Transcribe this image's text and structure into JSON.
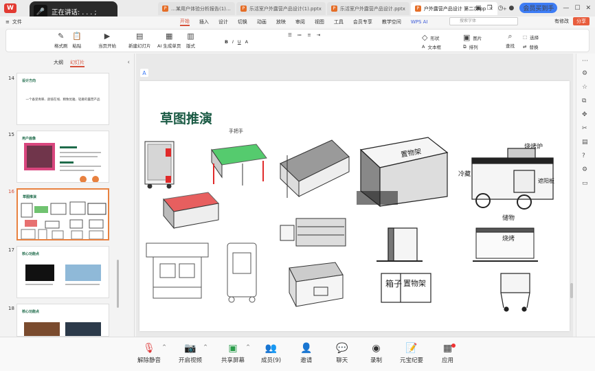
{
  "titlebar": {
    "logo": "W",
    "tabs": [
      {
        "label": "…某用户体验分析报告(1)…",
        "active": false
      },
      {
        "label": "乐活室户外露营产品设计(1).pptx",
        "active": false
      },
      {
        "label": "乐活室户外露营产品设计.pptx",
        "active": false
      },
      {
        "label": "户外露营产品设计 第二次.pp",
        "active": true
      }
    ],
    "new_tab": "+",
    "vip_label": "会员买到手"
  },
  "speaking": {
    "label": "正在讲话:  . . . ;"
  },
  "menubar": {
    "file": "文件",
    "items": [
      "开始",
      "插入",
      "设计",
      "切换",
      "动画",
      "放映",
      "审阅",
      "视图",
      "工具",
      "会员专享",
      "教学空间",
      "WPS AI"
    ],
    "active": "开始",
    "search_placeholder": "搜索字体",
    "right": [
      "有修改",
      "分享"
    ]
  },
  "ribbon": {
    "buttons": [
      "格式刷",
      "粘贴",
      "当页开始",
      "新建幻灯片",
      "AI 生成单页",
      "版式",
      "文本框",
      "排列",
      "查找",
      "形状",
      "图片",
      "选择",
      "替换"
    ]
  },
  "sidebar": {
    "tabs": [
      "大纲",
      "幻灯片"
    ],
    "active_tab": "幻灯片",
    "slides": [
      {
        "num": "14",
        "title": "设计方向",
        "text": "一个备受青睐、颜值在线、精致优雅、轻奢的露营产品"
      },
      {
        "num": "15",
        "title": "用户画像",
        "text": ""
      },
      {
        "num": "16",
        "title": "草图推演",
        "text": ""
      },
      {
        "num": "17",
        "title": "核心功能点",
        "text": ""
      },
      {
        "num": "18",
        "title": "核心功能点",
        "text": ""
      }
    ],
    "selected": "16"
  },
  "slide": {
    "title": "草图推演",
    "annotations": [
      "手把手",
      "置物架",
      "烧烤炉",
      "冷藏",
      "遮阳板",
      "储物",
      "箱子",
      "置物架",
      "烧烤"
    ]
  },
  "bottombar": {
    "buttons": [
      "解除静音",
      "开启视频",
      "共享屏幕",
      "成员(9)",
      "邀请",
      "聊天",
      "录制",
      "元宝纪要",
      "应用"
    ]
  },
  "colors": {
    "accent": "#d6503a",
    "slide_title": "#1a5a44",
    "sketch_red": "#e02a2a",
    "sketch_green": "#2bbf4a"
  }
}
